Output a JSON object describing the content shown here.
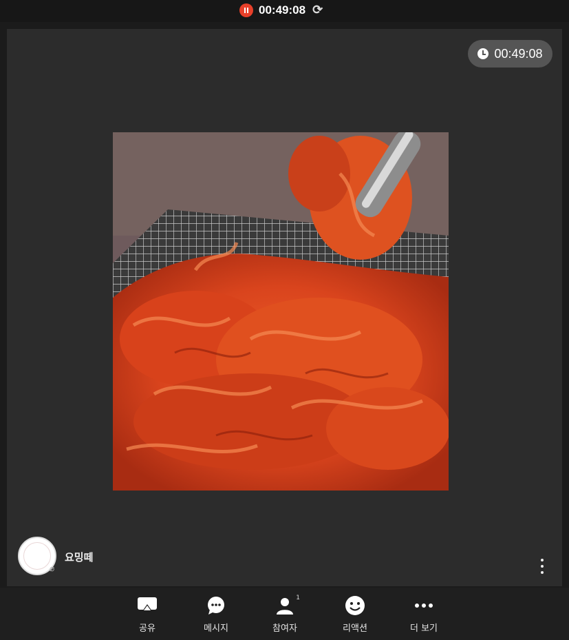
{
  "recording": {
    "elapsed": "00:49:08"
  },
  "stage": {
    "timer": "00:49:08"
  },
  "participant": {
    "name": "요밍떼"
  },
  "toolbar": {
    "items": [
      {
        "label": "공유",
        "icon": "share-screen-icon"
      },
      {
        "label": "메시지",
        "icon": "chat-icon"
      },
      {
        "label": "참여자",
        "icon": "participants-icon",
        "badge": "1"
      },
      {
        "label": "리액션",
        "icon": "smiley-icon"
      },
      {
        "label": "더 보기",
        "icon": "more-icon"
      }
    ]
  },
  "colors": {
    "record": "#e8402a",
    "stage_bg": "#2c2c2c",
    "toolbar_bg": "#1f1f1f"
  }
}
